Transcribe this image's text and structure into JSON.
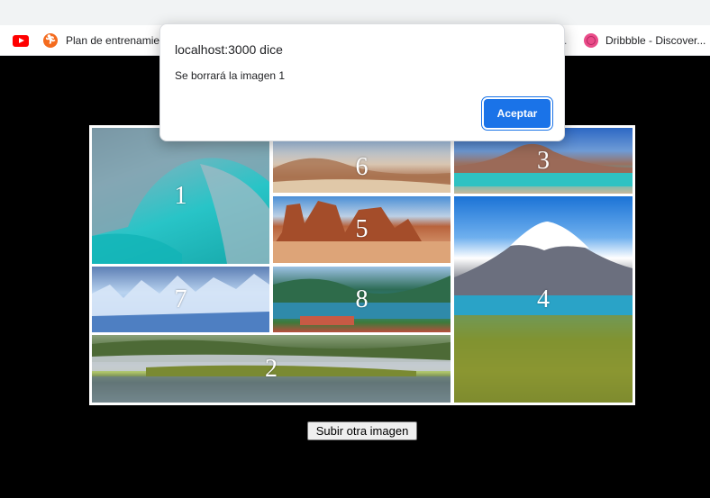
{
  "bookmarks": {
    "items": [
      {
        "label": "",
        "icon": "youtube-icon"
      },
      {
        "label": "Plan de entrenamie",
        "icon": "runner-icon"
      },
      {
        "label": "Dribbble - Discover...",
        "icon": "dribbble-icon"
      }
    ]
  },
  "dialog": {
    "title": "localhost:3000 dice",
    "message": "Se borrará la imagen 1",
    "ok_label": "Aceptar"
  },
  "gallery": {
    "tiles": [
      {
        "number": "1"
      },
      {
        "number": "6"
      },
      {
        "number": "3"
      },
      {
        "number": "5"
      },
      {
        "number": "4"
      },
      {
        "number": "7"
      },
      {
        "number": "8"
      },
      {
        "number": "2"
      }
    ]
  },
  "upload": {
    "label": "Subir otra imagen"
  },
  "colors": {
    "accent": "#1a73e8",
    "page_bg": "#000000",
    "youtube": "#ff0000",
    "dribbble": "#ea4c89"
  }
}
